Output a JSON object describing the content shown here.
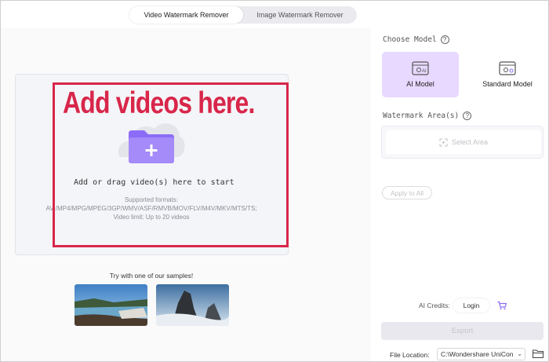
{
  "tabs": [
    {
      "label": "Video Watermark Remover",
      "active": true
    },
    {
      "label": "Image Watermark Remover",
      "active": false
    }
  ],
  "annotation": {
    "text": "Add videos here.",
    "color": "#d8264a"
  },
  "drop": {
    "title": "Add or drag video(s) here to start",
    "formats_label": "Supported formats:",
    "formats": "AVI/MP4/MPG/MPEG/3GP/WMV/ASF/RMVB/MOV/FLV/M4V/MKV/MTS/TS;",
    "limit": "Video limit: Up to 20 videos",
    "icon": "folder-plus-icon"
  },
  "samples": {
    "title": "Try with one of our samples!",
    "count": 2
  },
  "model": {
    "label": "Choose Model",
    "options": [
      {
        "label": "AI Model",
        "selected": true
      },
      {
        "label": "Standard Model",
        "selected": false
      }
    ]
  },
  "watermark": {
    "label": "Watermark Area(s)",
    "select_label": "Select Area"
  },
  "apply_label": "Apply to All",
  "credits": {
    "label": "AI Credits:",
    "login": "Login"
  },
  "export_label": "Export",
  "file_location": {
    "label": "File Location:",
    "value": "C:\\Wondershare UniCon"
  },
  "colors": {
    "accent": "#8b6cf6",
    "selected_card": "#e7d9ff",
    "annotation": "#d8264a"
  }
}
